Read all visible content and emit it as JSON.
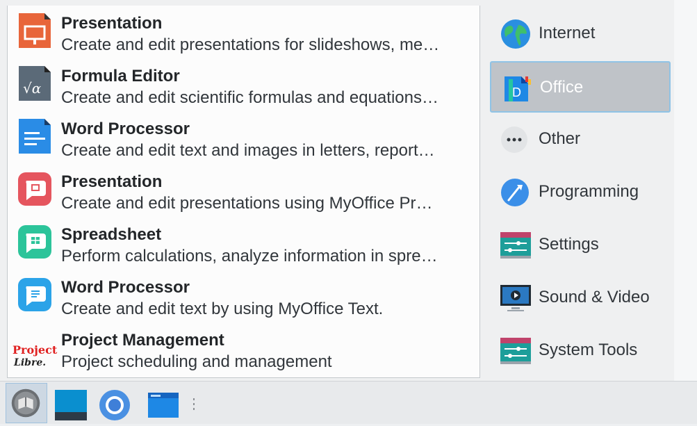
{
  "apps": [
    {
      "title": "Presentation",
      "desc": "Create and edit presentations for slideshows, me…",
      "icon": "libreoffice-impress-icon"
    },
    {
      "title": "Formula Editor",
      "desc": "Create and edit scientific formulas and equations…",
      "icon": "libreoffice-math-icon"
    },
    {
      "title": "Word Processor",
      "desc": "Create and edit text and images in letters, report…",
      "icon": "libreoffice-writer-icon"
    },
    {
      "title": "Presentation",
      "desc": "Create and edit presentations using MyOffice Pr…",
      "icon": "myoffice-presentation-icon"
    },
    {
      "title": "Spreadsheet",
      "desc": "Perform calculations, analyze information in spre…",
      "icon": "myoffice-spreadsheet-icon"
    },
    {
      "title": "Word Processor",
      "desc": "Create and edit text by using MyOffice Text.",
      "icon": "myoffice-text-icon"
    },
    {
      "title": "Project Management",
      "desc": "Project scheduling and management",
      "icon": "projectlibre-icon",
      "logo_text": [
        "Project",
        "Libre."
      ]
    }
  ],
  "categories": [
    {
      "label": "Internet",
      "icon": "globe-icon",
      "selected": false
    },
    {
      "label": "Office",
      "icon": "office-icon",
      "selected": true
    },
    {
      "label": "Other",
      "icon": "more-icon",
      "selected": false
    },
    {
      "label": "Programming",
      "icon": "programming-icon",
      "selected": false
    },
    {
      "label": "Settings",
      "icon": "settings-icon",
      "selected": false
    },
    {
      "label": "Sound & Video",
      "icon": "monitor-play-icon",
      "selected": false
    },
    {
      "label": "System Tools",
      "icon": "system-tools-icon",
      "selected": false
    }
  ],
  "taskbar": [
    {
      "icon": "app-launcher-icon"
    },
    {
      "icon": "desktop-icon"
    },
    {
      "icon": "chromium-icon"
    },
    {
      "icon": "file-manager-icon"
    },
    {
      "icon": "drag-handle-icon"
    }
  ],
  "colors": {
    "selection_bg": "#bfc3c8",
    "selection_border": "#8fc3e6"
  }
}
